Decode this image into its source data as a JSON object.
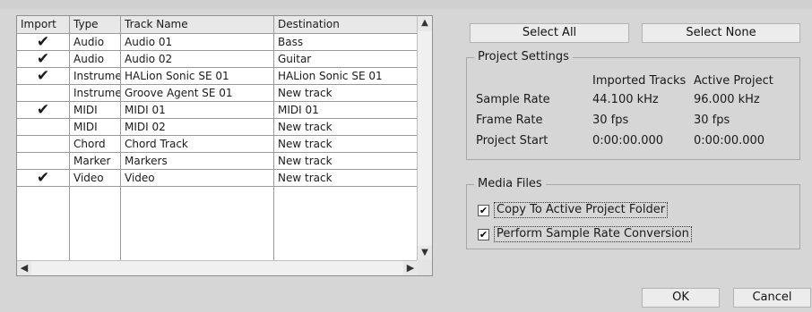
{
  "table": {
    "columns": [
      "Import",
      "Type",
      "Track Name",
      "Destination"
    ],
    "rows": [
      {
        "import": true,
        "type": "Audio",
        "name": "Audio 01",
        "dest": "Bass"
      },
      {
        "import": true,
        "type": "Audio",
        "name": "Audio 02",
        "dest": "Guitar"
      },
      {
        "import": true,
        "type": "Instrumen",
        "name": "HALion Sonic SE 01",
        "dest": "HALion Sonic SE 01"
      },
      {
        "import": false,
        "type": "Instrumen",
        "name": "Groove Agent SE 01",
        "dest": "New track"
      },
      {
        "import": true,
        "type": "MIDI",
        "name": "MIDI 01",
        "dest": "MIDI 01"
      },
      {
        "import": false,
        "type": "MIDI",
        "name": "MIDI 02",
        "dest": "New track"
      },
      {
        "import": false,
        "type": "Chord",
        "name": "Chord Track",
        "dest": "New track"
      },
      {
        "import": false,
        "type": "Marker",
        "name": "Markers",
        "dest": "New track"
      },
      {
        "import": true,
        "type": "Video",
        "name": "Video",
        "dest": "New track"
      }
    ],
    "check_glyph": "✔"
  },
  "buttons": {
    "select_all": "Select All",
    "select_none": "Select None",
    "ok": "OK",
    "cancel": "Cancel"
  },
  "project_settings": {
    "title": "Project Settings",
    "col_imported": "Imported Tracks",
    "col_active": "Active Project",
    "rows": [
      {
        "label": "Sample Rate",
        "imported": "44.100 kHz",
        "active": "96.000 kHz"
      },
      {
        "label": "Frame Rate",
        "imported": "30 fps",
        "active": "30 fps"
      },
      {
        "label": "Project Start",
        "imported": "0:00:00.000",
        "active": "0:00:00.000"
      }
    ]
  },
  "media_files": {
    "title": "Media Files",
    "copy_label": "Copy To Active Project Folder",
    "copy_checked": true,
    "convert_label": "Perform Sample Rate Conversion",
    "convert_checked": true
  },
  "icons": {
    "scroll_up": "up-arrow-icon",
    "scroll_down": "down-arrow-icon",
    "scroll_left": "left-arrow-icon",
    "scroll_right": "right-arrow-icon",
    "checkmark": "checkmark-icon"
  }
}
